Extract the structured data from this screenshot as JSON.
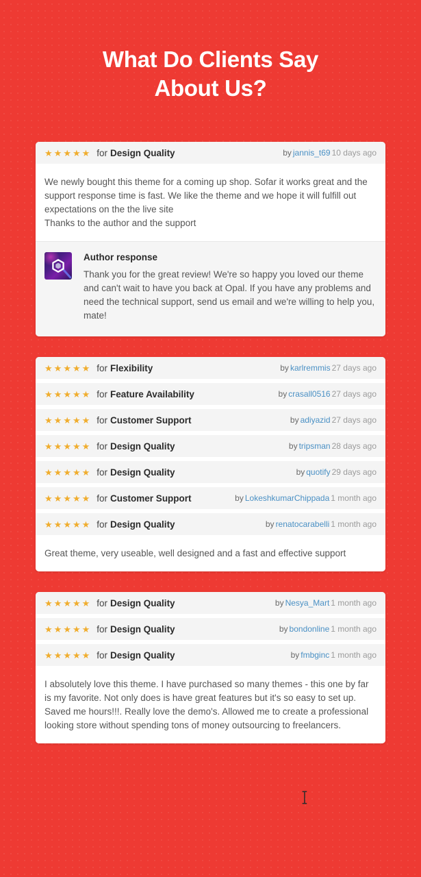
{
  "heading": {
    "line1": "What Do Clients Say",
    "line2": "About Us?"
  },
  "colors": {
    "background": "#ee3a33",
    "star": "#f0ad2e",
    "link": "#4a90c4",
    "card": "#ffffff",
    "row": "#f4f4f4",
    "heading_text": "#ffffff"
  },
  "labels": {
    "for": "for",
    "by": "by",
    "author_response_title": "Author response"
  },
  "star_glyph": "★",
  "cards": [
    {
      "ratings": [
        {
          "stars": 5,
          "criteria": "Design Quality",
          "author": "jannis_t69",
          "ago": "10 days ago"
        }
      ],
      "review": "We newly bought this theme for a coming up shop. Sofar it works great and the support response time is fast. We like the theme and we hope it will fulfill out expectations on the the live site\nThanks to the author and the support",
      "author_response": {
        "title": "Author response",
        "text": "Thank you for the great review! We're so happy you loved our theme and can't wait to have you back at Opal. If you have any problems and need the technical support, send us email and we're willing to help you, mate!",
        "avatar_icon": "hexagon-logo-icon"
      }
    },
    {
      "ratings": [
        {
          "stars": 5,
          "criteria": "Flexibility",
          "author": "karlremmis",
          "ago": "27 days ago"
        },
        {
          "stars": 5,
          "criteria": "Feature Availability",
          "author": "crasall0516",
          "ago": "27 days ago"
        },
        {
          "stars": 5,
          "criteria": "Customer Support",
          "author": "adiyazid",
          "ago": "27 days ago"
        },
        {
          "stars": 5,
          "criteria": "Design Quality",
          "author": "tripsman",
          "ago": "28 days ago"
        },
        {
          "stars": 5,
          "criteria": "Design Quality",
          "author": "quotify",
          "ago": "29 days ago"
        },
        {
          "stars": 5,
          "criteria": "Customer Support",
          "author": "LokeshkumarChippada",
          "ago": "1 month ago"
        },
        {
          "stars": 5,
          "criteria": "Design Quality",
          "author": "renatocarabelli",
          "ago": "1 month ago"
        }
      ],
      "review": "Great theme, very useable, well designed and a fast and effective support",
      "author_response": null
    },
    {
      "ratings": [
        {
          "stars": 5,
          "criteria": "Design Quality",
          "author": "Nesya_Mart",
          "ago": "1 month ago"
        },
        {
          "stars": 5,
          "criteria": "Design Quality",
          "author": "bondonline",
          "ago": "1 month ago"
        },
        {
          "stars": 5,
          "criteria": "Design Quality",
          "author": "fmbginc",
          "ago": "1 month ago"
        }
      ],
      "review": "I absolutely love this theme. I have purchased so many themes - this one by far is my favorite. Not only does is have great features but it's so easy to set up. Saved me hours!!!. Really love the demo's. Allowed me to create a professional looking store without spending tons of money outsourcing to freelancers.",
      "author_response": null
    }
  ]
}
